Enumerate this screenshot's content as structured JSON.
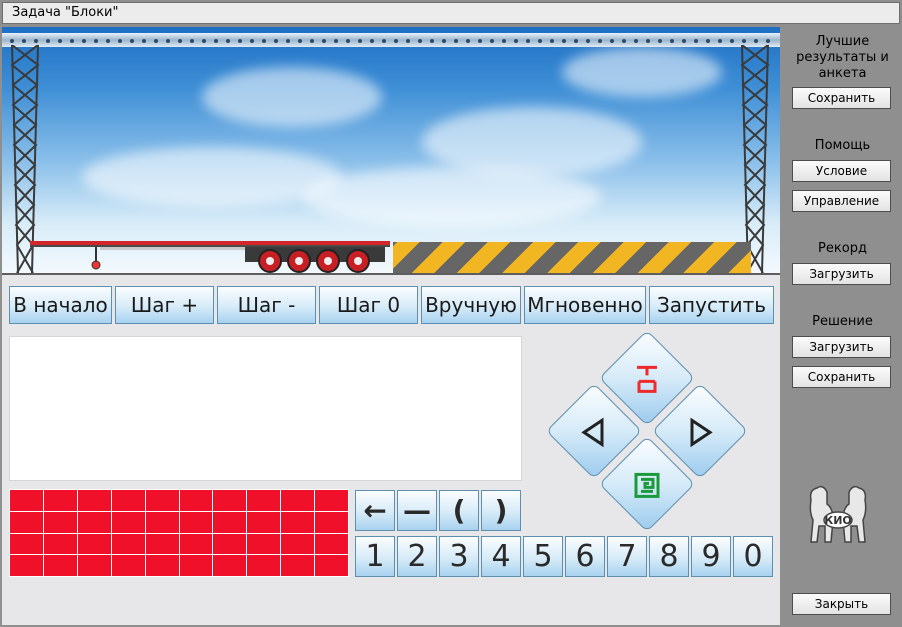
{
  "window": {
    "title": "Задача \"Блоки\""
  },
  "controls": {
    "to_start": "В начало",
    "step_forward": "Шаг +",
    "step_back": "Шаг -",
    "step_zero": "Шаг 0",
    "manual": "Вручную",
    "instant": "Мгновенно",
    "run": "Запустить"
  },
  "program": {
    "text": ""
  },
  "block_grid": {
    "rows": 4,
    "cols": 10,
    "color": "#f0102a"
  },
  "symbols": [
    "←",
    "—",
    "(",
    ")"
  ],
  "digits": [
    "1",
    "2",
    "3",
    "4",
    "5",
    "6",
    "7",
    "8",
    "9",
    "0"
  ],
  "dpad": {
    "up_icon": "crane-hook-icon",
    "left_icon": "arrow-left-icon",
    "right_icon": "arrow-right-icon",
    "down_icon": "grab-icon",
    "up_color": "#ee2a2a",
    "down_color": "#1a9a3a"
  },
  "sidebar": {
    "best_results_label": "Лучшие результаты и анкета",
    "best_save": "Сохранить",
    "help_label": "Помощь",
    "condition": "Условие",
    "management": "Управление",
    "record_label": "Рекорд",
    "record_load": "Загрузить",
    "solution_label": "Решение",
    "solution_load": "Загрузить",
    "solution_save": "Сохранить",
    "close": "Закрыть"
  },
  "logo": {
    "text": "КИО"
  },
  "colors": {
    "hazard_yellow": "#f3b623",
    "trailer_red": "#d3262b",
    "accent_blue": "#a8d2ef"
  }
}
